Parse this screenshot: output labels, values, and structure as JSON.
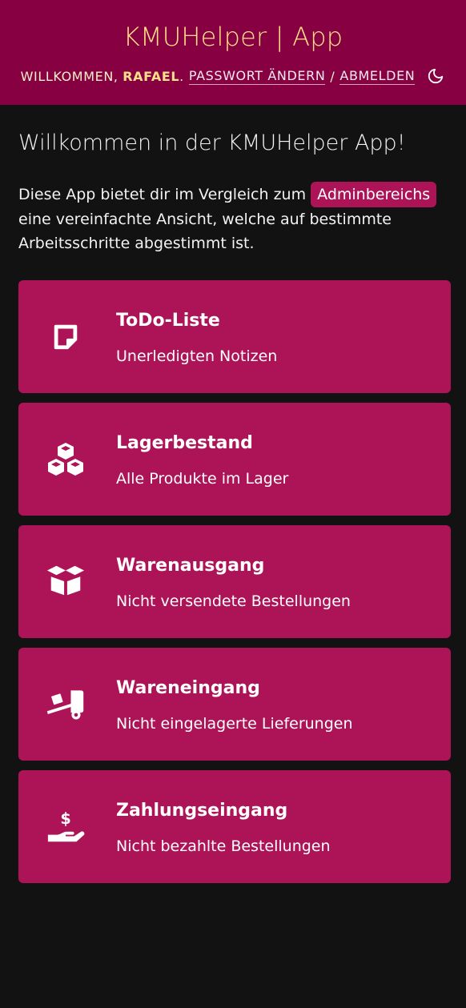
{
  "header": {
    "title": "KMUHelper | App",
    "welcome_prefix": "Willkommen,",
    "username": "Rafael",
    "dot": ".",
    "change_password": "Passwort ändern",
    "separator": "/",
    "logout": "Abmelden",
    "theme_icon": "moon-icon"
  },
  "main": {
    "heading": "Willkommen in der KMUHelper App!",
    "intro_before": "Diese App bietet dir im Vergleich zum ",
    "intro_link": "Adminbereichs",
    "intro_after": " eine vereinfachte Ansicht, welche auf bestimmte Arbeitsschritte abgestimmt ist."
  },
  "cards": [
    {
      "title": "ToDo-Liste",
      "subtitle": "Unerledigten Notizen",
      "icon": "sticky-note-icon"
    },
    {
      "title": "Lagerbestand",
      "subtitle": "Alle Produkte im Lager",
      "icon": "cubes-icon"
    },
    {
      "title": "Warenausgang",
      "subtitle": "Nicht versendete Bestellungen",
      "icon": "open-box-icon"
    },
    {
      "title": "Wareneingang",
      "subtitle": "Nicht eingelagerte Lieferungen",
      "icon": "dolly-icon"
    },
    {
      "title": "Zahlungseingang",
      "subtitle": "Nicht bezahlte Bestellungen",
      "icon": "hand-dollar-icon"
    }
  ],
  "colors": {
    "header_bg": "#870041",
    "card_bg": "#ad1457",
    "page_bg": "#121212",
    "title_yellow": "#ffe08a"
  }
}
